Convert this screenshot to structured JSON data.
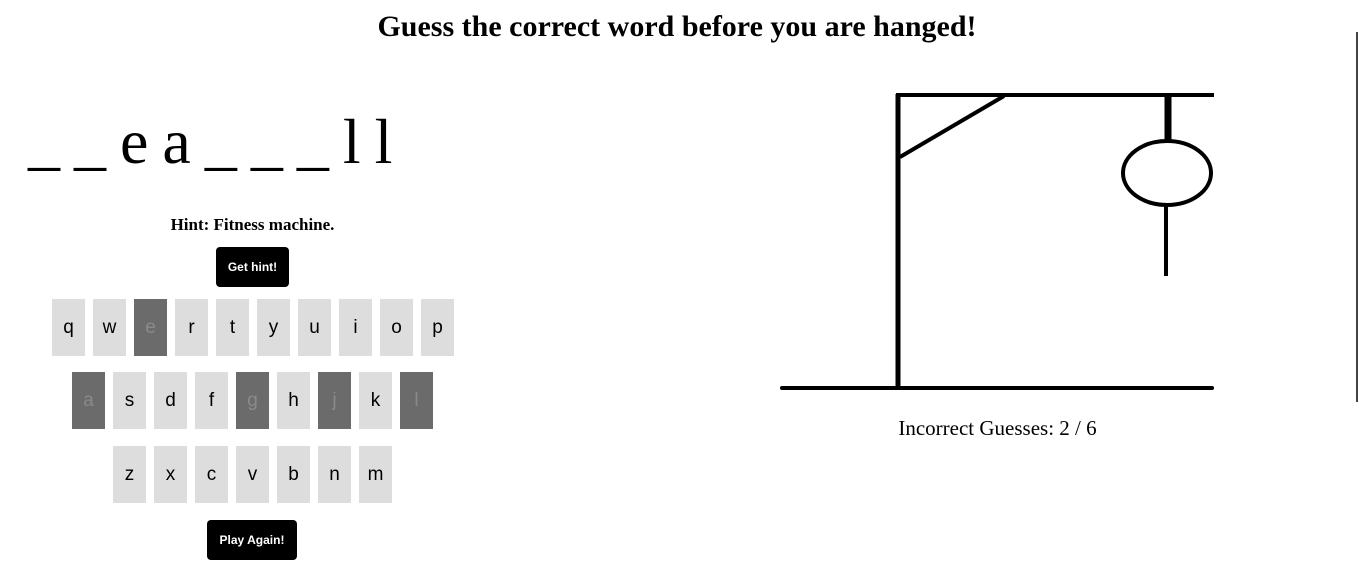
{
  "title": "Guess the correct word before you are hanged!",
  "word": [
    "_",
    "_",
    "e",
    "a",
    "_",
    "_",
    "_",
    "l",
    "l"
  ],
  "hint": {
    "text": "Hint: Fitness machine.",
    "button_label": "Get hint!"
  },
  "keyboard": {
    "row1": [
      {
        "letter": "q",
        "used": false
      },
      {
        "letter": "w",
        "used": false
      },
      {
        "letter": "e",
        "used": true
      },
      {
        "letter": "r",
        "used": false
      },
      {
        "letter": "t",
        "used": false
      },
      {
        "letter": "y",
        "used": false
      },
      {
        "letter": "u",
        "used": false
      },
      {
        "letter": "i",
        "used": false
      },
      {
        "letter": "o",
        "used": false
      },
      {
        "letter": "p",
        "used": false
      }
    ],
    "row2": [
      {
        "letter": "a",
        "used": true
      },
      {
        "letter": "s",
        "used": false
      },
      {
        "letter": "d",
        "used": false
      },
      {
        "letter": "f",
        "used": false
      },
      {
        "letter": "g",
        "used": true
      },
      {
        "letter": "h",
        "used": false
      },
      {
        "letter": "j",
        "used": true
      },
      {
        "letter": "k",
        "used": false
      },
      {
        "letter": "l",
        "used": true
      }
    ],
    "row3": [
      {
        "letter": "z",
        "used": false
      },
      {
        "letter": "x",
        "used": false
      },
      {
        "letter": "c",
        "used": false
      },
      {
        "letter": "v",
        "used": false
      },
      {
        "letter": "b",
        "used": false
      },
      {
        "letter": "n",
        "used": false
      },
      {
        "letter": "m",
        "used": false
      }
    ]
  },
  "play_again_label": "Play Again!",
  "incorrect_guesses": "Incorrect Guesses: 2 / 6",
  "hangman_parts_shown": [
    "head",
    "body"
  ],
  "colors": {
    "key_default": "#dddddd",
    "key_used": "#6b6b6b",
    "button": "#000000"
  }
}
